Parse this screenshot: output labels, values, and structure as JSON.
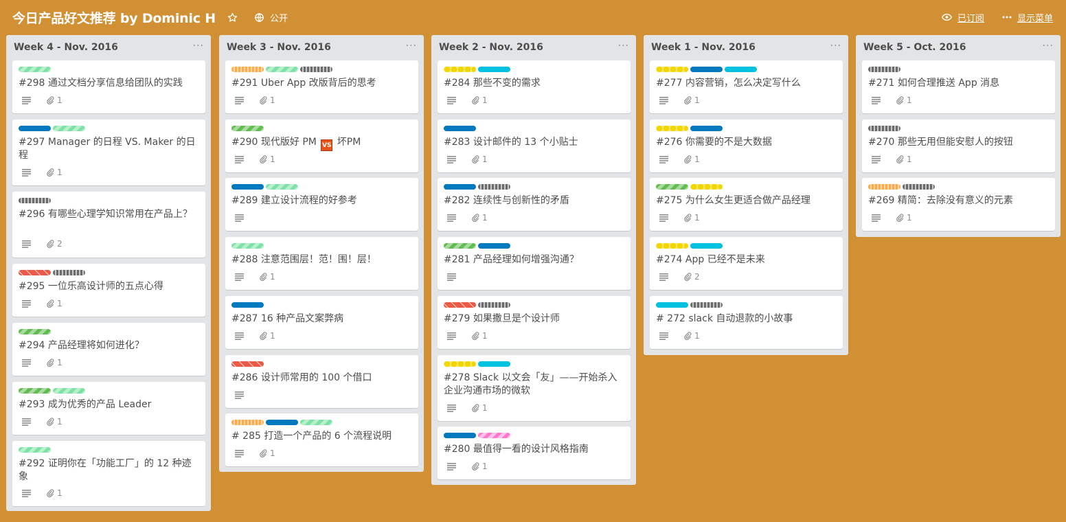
{
  "board": {
    "title": "今日产品好文推荐 by Dominic H",
    "visibility": "公开",
    "subscribed": "已订阅",
    "show_menu": "显示菜单"
  },
  "colors": {
    "background": "#d29034",
    "list": "#e2e4e6",
    "green": "#7ee2a8",
    "dark_green": "#61bd4f",
    "orange": "#ffab4a",
    "gray": "#6b6b6b",
    "blue": "#0079bf",
    "cyan": "#00c2e0",
    "pink": "#ff78cb",
    "red": "#eb5a46",
    "yellow": "#f2d600"
  },
  "icons": {
    "star": "star-icon",
    "visibility": "globe-icon",
    "subscribed": "eye-icon",
    "menu": "ellipsis-icon",
    "description": "description-icon",
    "attachment": "paperclip-icon"
  },
  "lists": [
    {
      "title": "Week 4 - Nov. 2016",
      "menu": "···",
      "cards": [
        {
          "labels": [
            "green"
          ],
          "title": "#298 通过文档分享信息给团队的实践",
          "attachments": "1"
        },
        {
          "labels": [
            "blue",
            "green"
          ],
          "title": "#297 Manager 的日程 VS. Maker 的日程",
          "attachments": "1"
        },
        {
          "labels": [
            "gray"
          ],
          "title": "#296 有哪些心理学知识常用在产品上？",
          "attachments": "2"
        },
        {
          "labels": [
            "red",
            "gray"
          ],
          "title": "#295 一位乐高设计师的五点心得",
          "attachments": "1"
        },
        {
          "labels": [
            "dark_green"
          ],
          "title": "#294 产品经理将如何进化？",
          "attachments": "1"
        },
        {
          "labels": [
            "dark_green",
            "green"
          ],
          "title": "#293 成为优秀的产品 Leader",
          "attachments": "1"
        },
        {
          "labels": [
            "green"
          ],
          "title": "#292 证明你在「功能工厂」的 12 种迹象",
          "attachments": "1"
        }
      ]
    },
    {
      "title": "Week 3 - Nov. 2016",
      "menu": "···",
      "cards": [
        {
          "labels": [
            "orange",
            "green",
            "gray"
          ],
          "title": "#291 Uber App 改版背后的思考",
          "attachments": "1"
        },
        {
          "labels": [
            "dark_green"
          ],
          "title_before": "#290 现代版好 PM",
          "title_badge": "VS",
          "title_after": "坏PM",
          "attachments": "1"
        },
        {
          "labels": [
            "blue",
            "green"
          ],
          "title": "#289 建立设计流程的好参考",
          "attachments": ""
        },
        {
          "labels": [
            "green"
          ],
          "title": "#288 注意范围层！范！围！层！",
          "attachments": "1"
        },
        {
          "labels": [
            "blue"
          ],
          "title": "#287 16 种产品文案弊病",
          "attachments": "1"
        },
        {
          "labels": [
            "red"
          ],
          "title": "#286 设计师常用的 100 个借口",
          "attachments": ""
        },
        {
          "labels": [
            "orange",
            "blue",
            "green"
          ],
          "title": "# 285 打造一个产品的 6 个流程说明",
          "attachments": "1"
        }
      ]
    },
    {
      "title": "Week 2 - Nov. 2016",
      "menu": "···",
      "cards": [
        {
          "labels": [
            "yellow",
            "cyan"
          ],
          "title": "#284 那些不变的需求",
          "attachments": "1"
        },
        {
          "labels": [
            "blue"
          ],
          "title": "#283 设计邮件的 13 个小贴士",
          "attachments": "1"
        },
        {
          "labels": [
            "blue",
            "gray"
          ],
          "title": "#282 连续性与创新性的矛盾",
          "attachments": "1"
        },
        {
          "labels": [
            "dark_green",
            "blue"
          ],
          "title": "#281 产品经理如何增强沟通？",
          "attachments": ""
        },
        {
          "labels": [
            "red",
            "gray"
          ],
          "title": "#279 如果撒旦是个设计师",
          "attachments": "1"
        },
        {
          "labels": [
            "yellow",
            "cyan"
          ],
          "title": "#278 Slack 以文会「友」——开始杀入企业沟通市场的微软",
          "attachments": "1"
        },
        {
          "labels": [
            "blue",
            "pink"
          ],
          "title": "#280 最值得一看的设计风格指南",
          "attachments": "1"
        }
      ]
    },
    {
      "title": "Week 1 - Nov. 2016",
      "menu": "···",
      "cards": [
        {
          "labels": [
            "yellow",
            "blue",
            "cyan"
          ],
          "title": "#277 内容营销，怎么决定写什么",
          "attachments": "1"
        },
        {
          "labels": [
            "yellow",
            "blue"
          ],
          "title": "#276 你需要的不是大数据",
          "attachments": "1"
        },
        {
          "labels": [
            "dark_green",
            "yellow"
          ],
          "title": "#275 为什么女生更适合做产品经理",
          "attachments": "1"
        },
        {
          "labels": [
            "yellow",
            "cyan"
          ],
          "title": "#274 App 已经不是未来",
          "attachments": "2"
        },
        {
          "labels": [
            "cyan",
            "gray"
          ],
          "title": "# 272 slack 自动退款的小故事",
          "attachments": "1"
        }
      ]
    },
    {
      "title": "Week 5 - Oct. 2016",
      "menu": "···",
      "cards": [
        {
          "labels": [
            "gray"
          ],
          "title": "#271 如何合理推送 App 消息",
          "attachments": "1"
        },
        {
          "labels": [
            "gray"
          ],
          "title": "#270 那些无用但能安慰人的按钮",
          "attachments": "1"
        },
        {
          "labels": [
            "orange",
            "gray"
          ],
          "title": "#269 精简：去除没有意义的元素",
          "attachments": "1"
        }
      ]
    }
  ]
}
